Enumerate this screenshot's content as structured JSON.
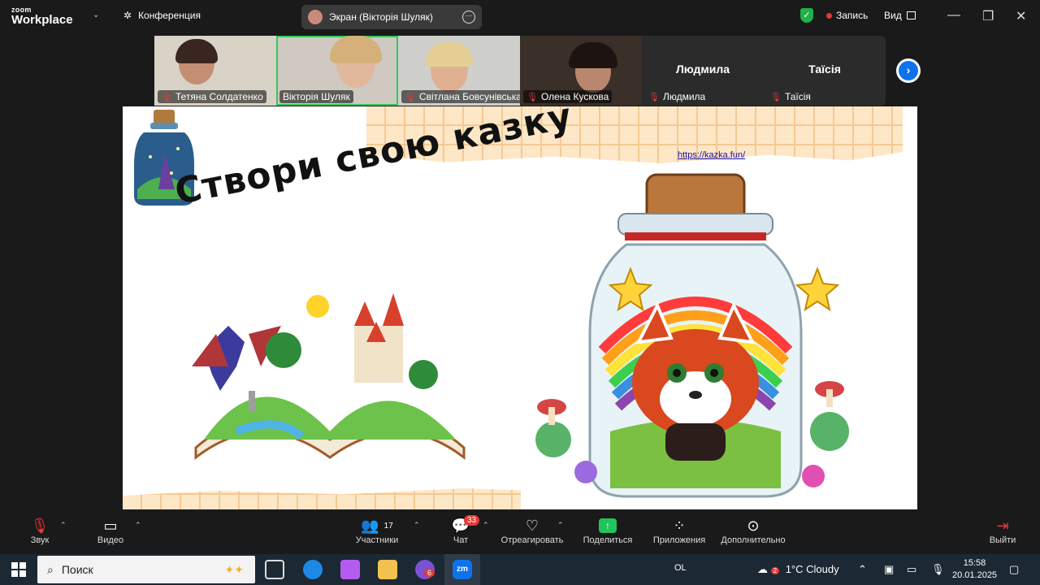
{
  "topbar": {
    "logo_line1": "zoom",
    "logo_line2": "Workplace",
    "conference_label": "Конференция",
    "screen_share_label": "Экран (Вікторія Шуляк)",
    "record_label": "Запись",
    "view_label": "Вид"
  },
  "participants": [
    {
      "name": "Тетяна Солдатенко",
      "video": true
    },
    {
      "name": "Вікторія Шуляк",
      "video": true,
      "active": true
    },
    {
      "name": "Світлана Бовсунівська",
      "video": true
    },
    {
      "name": "Олена Кускова",
      "video": true
    },
    {
      "name": "Людмила",
      "video": false,
      "display_name": "Людмила"
    },
    {
      "name": "Таїсія",
      "video": false,
      "display_name": "Таїсія"
    }
  ],
  "slide": {
    "title": "Створи свою казку",
    "link": "https://kazka.fun/"
  },
  "controls": {
    "audio": "Звук",
    "video": "Видео",
    "participants": "Участники",
    "participants_count": "17",
    "chat": "Чат",
    "chat_badge": "33",
    "react": "Отреагировать",
    "share": "Поделиться",
    "apps": "Приложения",
    "more": "Дополнительно",
    "leave": "Выйти"
  },
  "taskbar": {
    "search_placeholder": "Поиск",
    "viber_badge": "6",
    "lang": "OL",
    "weather_badge": "2",
    "weather": "1°C  Cloudy",
    "time": "15:58",
    "date": "20.01.2025"
  },
  "colors": {
    "accent_green": "#35c759",
    "record_red": "#e53935",
    "zoom_blue": "#0e72ed"
  }
}
